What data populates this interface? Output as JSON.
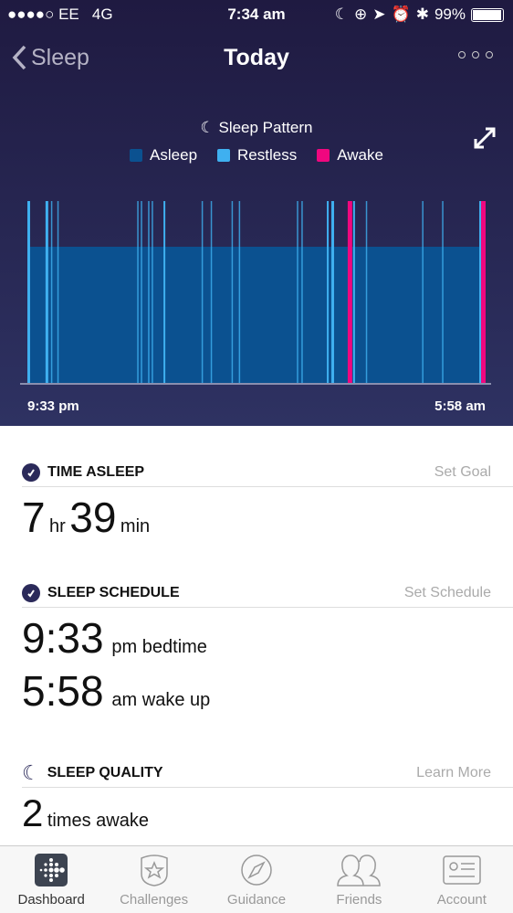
{
  "status": {
    "carrier": "●●●●○ EE",
    "network": "4G",
    "time": "7:34 am",
    "battery": "99%"
  },
  "nav": {
    "back_label": "Sleep",
    "title": "Today"
  },
  "chart": {
    "title": "Sleep Pattern",
    "legend": [
      {
        "label": "Asleep",
        "color": "#0b5190"
      },
      {
        "label": "Restless",
        "color": "#3fb0f0"
      },
      {
        "label": "Awake",
        "color": "#f0077f"
      }
    ],
    "start_label": "9:33 pm",
    "end_label": "5:58 am"
  },
  "chart_data": {
    "type": "bar",
    "x_range": [
      "21:33",
      "05:58"
    ],
    "base_stage": "Asleep",
    "events": [
      {
        "stage": "Restless",
        "start": "21:33",
        "minutes": 3
      },
      {
        "stage": "Restless",
        "start": "21:53",
        "minutes": 3
      },
      {
        "stage": "Restless",
        "start": "21:59",
        "minutes": 1
      },
      {
        "stage": "Restless",
        "start": "22:06",
        "minutes": 1
      },
      {
        "stage": "Restless",
        "start": "23:34",
        "minutes": 1
      },
      {
        "stage": "Restless",
        "start": "23:38",
        "minutes": 1
      },
      {
        "stage": "Restless",
        "start": "23:46",
        "minutes": 1
      },
      {
        "stage": "Restless",
        "start": "23:50",
        "minutes": 1
      },
      {
        "stage": "Restless",
        "start": "00:03",
        "minutes": 2
      },
      {
        "stage": "Restless",
        "start": "00:45",
        "minutes": 1
      },
      {
        "stage": "Restless",
        "start": "00:55",
        "minutes": 1
      },
      {
        "stage": "Restless",
        "start": "01:18",
        "minutes": 1
      },
      {
        "stage": "Restless",
        "start": "01:26",
        "minutes": 1
      },
      {
        "stage": "Restless",
        "start": "02:30",
        "minutes": 1
      },
      {
        "stage": "Restless",
        "start": "02:35",
        "minutes": 1
      },
      {
        "stage": "Restless",
        "start": "03:03",
        "minutes": 2
      },
      {
        "stage": "Restless",
        "start": "03:08",
        "minutes": 3
      },
      {
        "stage": "Awake",
        "start": "03:26",
        "minutes": 5
      },
      {
        "stage": "Restless",
        "start": "03:32",
        "minutes": 2
      },
      {
        "stage": "Restless",
        "start": "03:46",
        "minutes": 1
      },
      {
        "stage": "Restless",
        "start": "04:48",
        "minutes": 1
      },
      {
        "stage": "Restless",
        "start": "05:10",
        "minutes": 1
      },
      {
        "stage": "Restless",
        "start": "05:51",
        "minutes": 2
      },
      {
        "stage": "Awake",
        "start": "05:53",
        "minutes": 5
      }
    ]
  },
  "time_asleep": {
    "title": "TIME ASLEEP",
    "action": "Set Goal",
    "hours": "7",
    "hr_unit": "hr",
    "minutes": "39",
    "min_unit": "min"
  },
  "schedule": {
    "title": "SLEEP SCHEDULE",
    "action": "Set Schedule",
    "bedtime": "9:33",
    "bedtime_suffix": "pm bedtime",
    "wake": "5:58",
    "wake_suffix": "am wake up"
  },
  "quality": {
    "title": "SLEEP QUALITY",
    "action": "Learn More",
    "count": "2",
    "count_suffix": "times awake"
  },
  "tabs": [
    {
      "label": "Dashboard",
      "icon": "fitbit-logo-icon"
    },
    {
      "label": "Challenges",
      "icon": "star-badge-icon"
    },
    {
      "label": "Guidance",
      "icon": "compass-icon"
    },
    {
      "label": "Friends",
      "icon": "friends-icon"
    },
    {
      "label": "Account",
      "icon": "id-card-icon"
    }
  ]
}
